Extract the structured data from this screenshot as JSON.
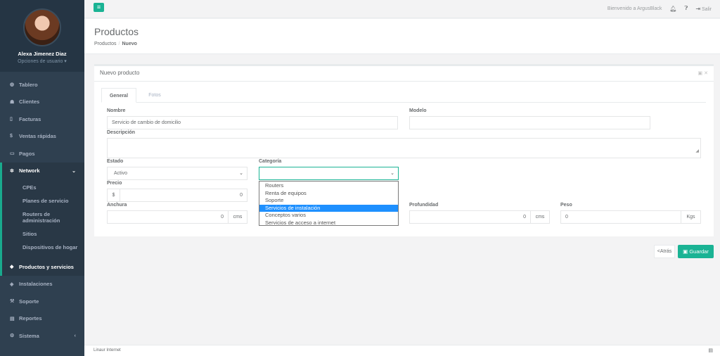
{
  "user": {
    "name": "Alexa Jimenez Diaz",
    "options": "Opciones de usuario ▾"
  },
  "nav": {
    "tablero": "Tablero",
    "clientes": "Clientes",
    "facturas": "Facturas",
    "ventas": "Ventas rápidas",
    "pagos": "Pagos",
    "network": "Network",
    "network_sub": [
      "CPEs",
      "Planes de servicio",
      "Routers de administración",
      "Sitios",
      "Dispositivos de hogar"
    ],
    "productos": "Productos y servicios",
    "instalaciones": "Instalaciones",
    "soporte": "Soporte",
    "reportes": "Reportes",
    "sistema": "Sistema"
  },
  "topbar": {
    "welcome": "Bienvenido a ArgusBlack",
    "logout": "Salir"
  },
  "heading": {
    "title": "Productos",
    "crumb_root": "Productos",
    "crumb_current": "Nuevo"
  },
  "panel": {
    "title": "Nuevo producto"
  },
  "tabs": {
    "general": "General",
    "fotos": "Fotos"
  },
  "form": {
    "nombre_label": "Nombre",
    "nombre_value": "Servicio de cambio de domicilio",
    "modelo_label": "Modelo",
    "modelo_value": "",
    "descripcion_label": "Descripción",
    "estado_label": "Estado",
    "estado_value": "Activo",
    "categoria_label": "Categoría",
    "categoria_value": "",
    "precio_label": "Precio",
    "precio_prefix": "$",
    "precio_value": "0",
    "anchura_label": "Anchura",
    "anchura_value": "0",
    "anchura_unit": "cms",
    "profundidad_label": "Profundidad",
    "profundidad_value": "0",
    "profundidad_unit": "cms",
    "peso_label": "Peso",
    "peso_value": "0",
    "peso_unit": "Kgs"
  },
  "categoria_options": [
    "Routers",
    "Renta de equipos",
    "Soporte",
    "Servicios de instalación",
    "Conceptos varios",
    "Servicios de acceso a internet"
  ],
  "categoria_highlighted": "Servicios de instalación",
  "buttons": {
    "back": "<Atrás",
    "save": "Guardar"
  },
  "footer": {
    "text": "Linaur Internet"
  },
  "colors": {
    "sidebar": "#2f4050",
    "accent": "#1ab394",
    "highlight": "#1e90ff"
  }
}
